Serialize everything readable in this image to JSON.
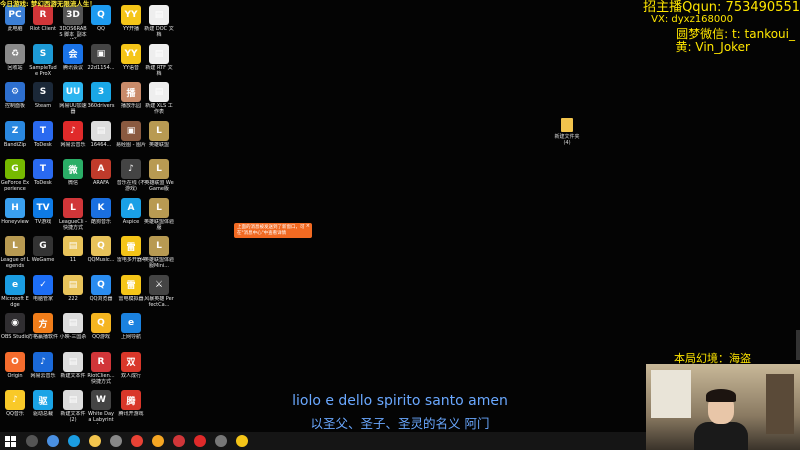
{
  "top_note": "今日游戏: 梦幻西游无限流人生！",
  "stream_info": {
    "line1": "招主播Qqun: 753490551",
    "line2": "VX: dyxz168000",
    "line3": "圆梦微信: t: tankoui_",
    "line4": "黄: Vin_Joker"
  },
  "desktop_icons": [
    [
      {
        "label": "此电脑",
        "color": "#3b7fd6",
        "glyph": "PC"
      },
      {
        "label": "回收站",
        "color": "#8a8a8a",
        "glyph": "♻"
      },
      {
        "label": "控制面板",
        "color": "#2d6fcf",
        "glyph": "⚙"
      },
      {
        "label": "BandiZip",
        "color": "#2a88e0",
        "glyph": "Z"
      },
      {
        "label": "GeForce Experience",
        "color": "#76b900",
        "glyph": "G"
      },
      {
        "label": "Honeyview",
        "color": "#3aa0ef",
        "glyph": "H"
      },
      {
        "label": "League of Legends",
        "color": "#b89a52",
        "glyph": "L"
      },
      {
        "label": "Microsoft Edge",
        "color": "#1b9de2",
        "glyph": "e"
      },
      {
        "label": "OBS Studio",
        "color": "#302e31",
        "glyph": "◉"
      },
      {
        "label": "Origin",
        "color": "#f56c2d",
        "glyph": "O"
      },
      {
        "label": "QQ音乐",
        "color": "#f9c928",
        "glyph": "♪"
      }
    ],
    [
      {
        "label": "Riot Client",
        "color": "#d13639",
        "glyph": "R"
      },
      {
        "label": "SampleTude ProX",
        "color": "#1d9ad6",
        "glyph": "S"
      },
      {
        "label": "Steam",
        "color": "#1b2838",
        "glyph": "S"
      },
      {
        "label": "ToDesk",
        "color": "#2a6af0",
        "glyph": "T"
      },
      {
        "label": "ToDesk",
        "color": "#2a6af0",
        "glyph": "T"
      },
      {
        "label": "TV游戏",
        "color": "#0e7be6",
        "glyph": "TV"
      },
      {
        "label": "WeGame",
        "color": "#333",
        "glyph": "G"
      },
      {
        "label": "电脑管家",
        "color": "#1d6ef5",
        "glyph": "✓"
      },
      {
        "label": "方格赢播软件",
        "color": "#f07d1a",
        "glyph": "方"
      },
      {
        "label": "网易云音乐",
        "color": "#1a69d9",
        "glyph": "♪"
      },
      {
        "label": "驱动总裁",
        "color": "#1aa4e6",
        "glyph": "驱"
      }
    ],
    [
      {
        "label": "3DOS6RABS 脚本_副本(1)",
        "color": "#555",
        "glyph": "3D"
      },
      {
        "label": "腾讯会议",
        "color": "#1a73e8",
        "glyph": "会"
      },
      {
        "label": "网易UU加速器",
        "color": "#2bb5f0",
        "glyph": "UU"
      },
      {
        "label": "网易云音乐",
        "color": "#e02a2a",
        "glyph": "♪"
      },
      {
        "label": "微信",
        "color": "#2aae67",
        "glyph": "微"
      },
      {
        "label": "LeagueCli - 快捷方式",
        "color": "#d13639",
        "glyph": "L"
      },
      {
        "label": "11",
        "color": "#e8c35a",
        "glyph": "▤"
      },
      {
        "label": "222",
        "color": "#e8c35a",
        "glyph": "▤"
      },
      {
        "label": "小映-三国杀",
        "color": "#ddd",
        "glyph": "▤"
      },
      {
        "label": "新建文本件",
        "color": "#ddd",
        "glyph": "▤"
      },
      {
        "label": "新建文本件(2)",
        "color": "#ddd",
        "glyph": "▤"
      }
    ],
    [
      {
        "label": "QQ",
        "color": "#1d9bf0",
        "glyph": "Q"
      },
      {
        "label": "22d1154...",
        "color": "#444",
        "glyph": "▣"
      },
      {
        "label": "360drivers",
        "color": "#1aa7e6",
        "glyph": "3"
      },
      {
        "label": "16464...",
        "color": "#ddd",
        "glyph": "▤"
      },
      {
        "label": "ARAFA",
        "color": "#c03b2b",
        "glyph": "A"
      },
      {
        "label": "酷狗音乐",
        "color": "#1a6fe0",
        "glyph": "K"
      },
      {
        "label": "QQMusic...",
        "color": "#e8c35a",
        "glyph": "Q"
      },
      {
        "label": "QQ浏览器",
        "color": "#2a8cf0",
        "glyph": "Q"
      },
      {
        "label": "QQ游戏",
        "color": "#f5b520",
        "glyph": "Q"
      },
      {
        "label": "RiotClien... 快捷方式",
        "color": "#d13639",
        "glyph": "R"
      },
      {
        "label": "White Day a Labyrinth...",
        "color": "#444",
        "glyph": "W"
      }
    ],
    [
      {
        "label": "YY开播",
        "color": "#f5c518",
        "glyph": "YY"
      },
      {
        "label": "YY语音",
        "color": "#f5c518",
        "glyph": "YY"
      },
      {
        "label": "播放乐园",
        "color": "#c98b6a",
        "glyph": "播"
      },
      {
        "label": "易经图 - 图片",
        "color": "#8a5a40",
        "glyph": "▣"
      },
      {
        "label": "音乐在线 (不游戏)",
        "color": "#444",
        "glyph": "♪"
      },
      {
        "label": "Aspice",
        "color": "#1aa0e6",
        "glyph": "A"
      },
      {
        "label": "雷电多开器4",
        "color": "#f5c518",
        "glyph": "雷"
      },
      {
        "label": "雷电模拟器",
        "color": "#f5c518",
        "glyph": "雷"
      },
      {
        "label": "上网导航",
        "color": "#1b82e0",
        "glyph": "e"
      },
      {
        "label": "双人成行",
        "color": "#d9372a",
        "glyph": "双"
      },
      {
        "label": "腾讯开游戏",
        "color": "#d9372a",
        "glyph": "腾"
      }
    ],
    [
      {
        "label": "新建 DOC 文档",
        "color": "#eee",
        "glyph": "▤"
      },
      {
        "label": "新建 RTF 文档",
        "color": "#eee",
        "glyph": "▤"
      },
      {
        "label": "新建 XLS 工作表",
        "color": "#eee",
        "glyph": "▤"
      },
      {
        "label": "英雄联盟",
        "color": "#b89a52",
        "glyph": "L"
      },
      {
        "label": "英雄联盟 WeGame版",
        "color": "#b89a52",
        "glyph": "L"
      },
      {
        "label": "英雄联盟体验服",
        "color": "#b89a52",
        "glyph": "L"
      },
      {
        "label": "英雄联盟体验服Mini...",
        "color": "#b89a52",
        "glyph": "L"
      },
      {
        "label": "风暴英雄 PerfectCa...",
        "color": "#444",
        "glyph": "⚔"
      }
    ]
  ],
  "folder": {
    "label": "新建文件夹(4)"
  },
  "popup": {
    "text": "上面的消息被发送到了新窗口，可在\"消息中心\"中查看详情",
    "close": "×"
  },
  "subtitle_it": "liolo e dello spirito santo amen",
  "subtitle_zh": "以圣父、圣子、圣灵的名义 阿门",
  "cam_label": "本局幻境：海盗",
  "taskbar_icons": [
    {
      "name": "search-icon",
      "color": "#555"
    },
    {
      "name": "task-view-icon",
      "color": "#4a90e2"
    },
    {
      "name": "edge-icon",
      "color": "#1b9de2"
    },
    {
      "name": "folder-icon",
      "color": "#f2c44d"
    },
    {
      "name": "store-icon",
      "color": "#888"
    },
    {
      "name": "chrome-icon",
      "color": "#e94235"
    },
    {
      "name": "wegame-icon",
      "color": "#f5a623"
    },
    {
      "name": "app-icon",
      "color": "#d13639"
    },
    {
      "name": "netease-icon",
      "color": "#e02a2a"
    },
    {
      "name": "obs-icon",
      "color": "#777"
    },
    {
      "name": "yy-icon",
      "color": "#f5c518"
    }
  ]
}
